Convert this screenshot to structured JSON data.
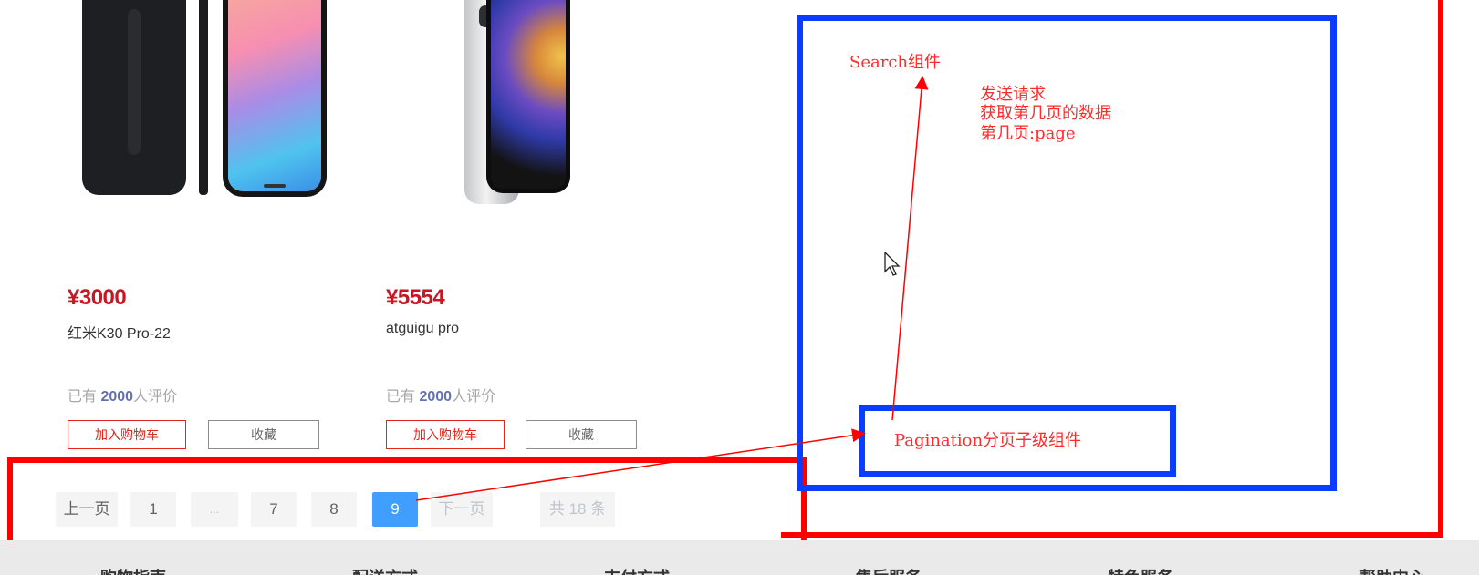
{
  "products": [
    {
      "price": "¥3000",
      "name": "红米K30 Pro-22",
      "reviews_prefix": "已有",
      "reviews_count": "2000",
      "reviews_suffix": "人评价",
      "add_cart": "加入购物车",
      "favorite": "收藏",
      "image": "redmi-phone-image"
    },
    {
      "price": "¥5554",
      "name": "atguigu pro",
      "reviews_prefix": "已有",
      "reviews_count": "2000",
      "reviews_suffix": "人评价",
      "add_cart": "加入购物车",
      "favorite": "收藏",
      "image": "iphone-image"
    }
  ],
  "pagination": {
    "prev": "上一页",
    "pages": [
      "1",
      "...",
      "7",
      "8",
      "9"
    ],
    "current": "9",
    "next": "下一页",
    "total": "共 18 条"
  },
  "annotations": {
    "search_component": "Search组件",
    "request_note": [
      "发送请求",
      "获取第几页的数据",
      "第几页:page"
    ],
    "pagination_component": "Pagination分页子级组件"
  },
  "footer": {
    "items": [
      "购物指南",
      "配送方式",
      "支付方式",
      "售后服务",
      "特色服务",
      "帮助中心"
    ]
  },
  "colors": {
    "price": "#c81623",
    "annotation_red": "#ff0000",
    "annotation_blue": "#0a3dff",
    "pagination_active": "#409eff"
  }
}
